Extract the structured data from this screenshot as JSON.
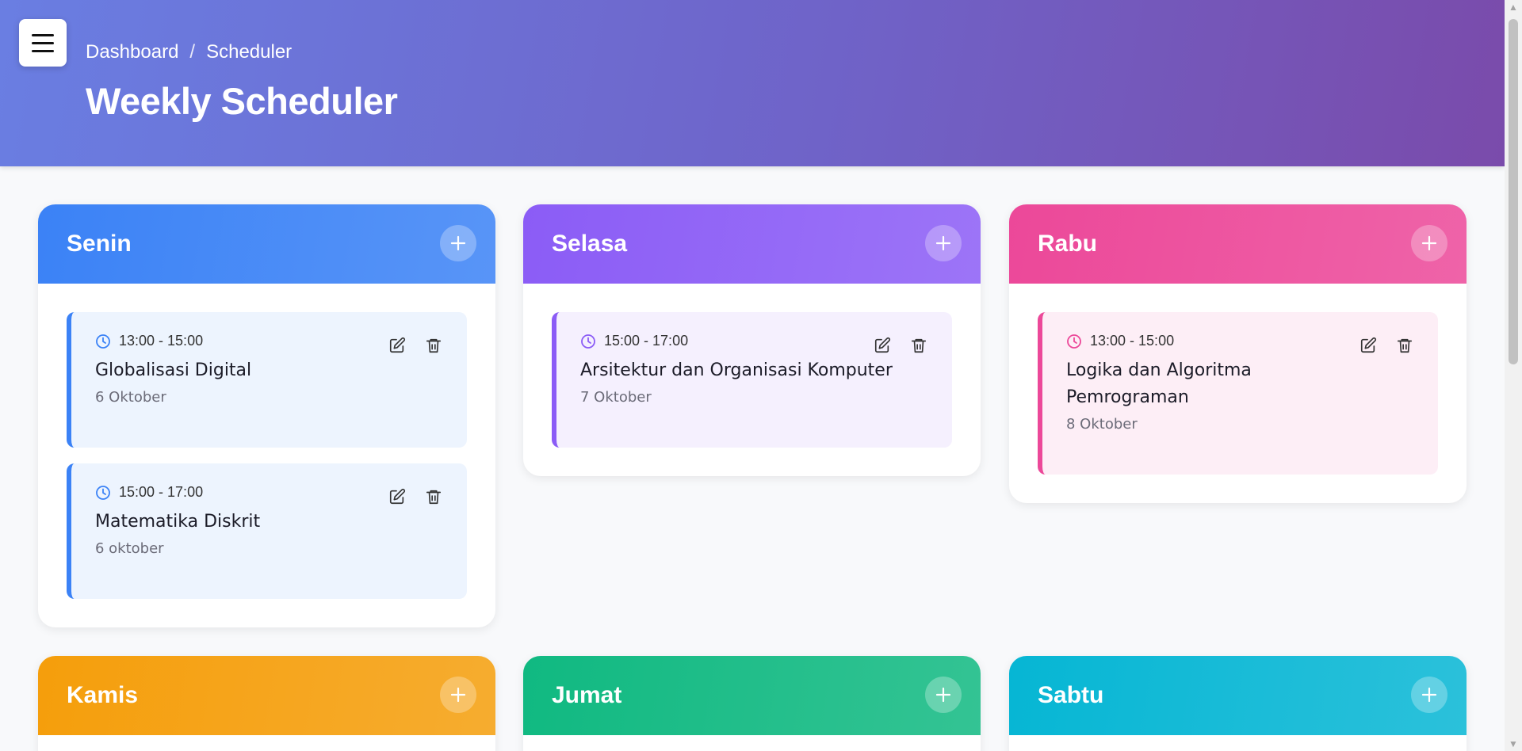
{
  "header": {
    "breadcrumb": [
      "Dashboard",
      "/",
      "Scheduler"
    ],
    "title": "Weekly Scheduler"
  },
  "days": [
    {
      "name": "Senin",
      "color": "#3b82f6",
      "events": [
        {
          "time": "13:00 - 15:00",
          "title": "Globalisasi Digital",
          "date": "6 Oktober"
        },
        {
          "time": "15:00 - 17:00",
          "title": "Matematika Diskrit",
          "date": "6 oktober"
        }
      ]
    },
    {
      "name": "Selasa",
      "color": "#8b5cf6",
      "events": [
        {
          "time": "15:00 - 17:00",
          "title": "Arsitektur dan Organisasi Komputer",
          "date": "7 Oktober"
        }
      ]
    },
    {
      "name": "Rabu",
      "color": "#ec4899",
      "events": [
        {
          "time": "13:00 - 15:00",
          "title": "Logika dan Algoritma Pemrograman",
          "date": "8 Oktober"
        }
      ]
    },
    {
      "name": "Kamis",
      "color": "#f59e0b",
      "events": []
    },
    {
      "name": "Jumat",
      "color": "#10b981",
      "events": []
    },
    {
      "name": "Sabtu",
      "color": "#06b6d4",
      "events": []
    }
  ]
}
